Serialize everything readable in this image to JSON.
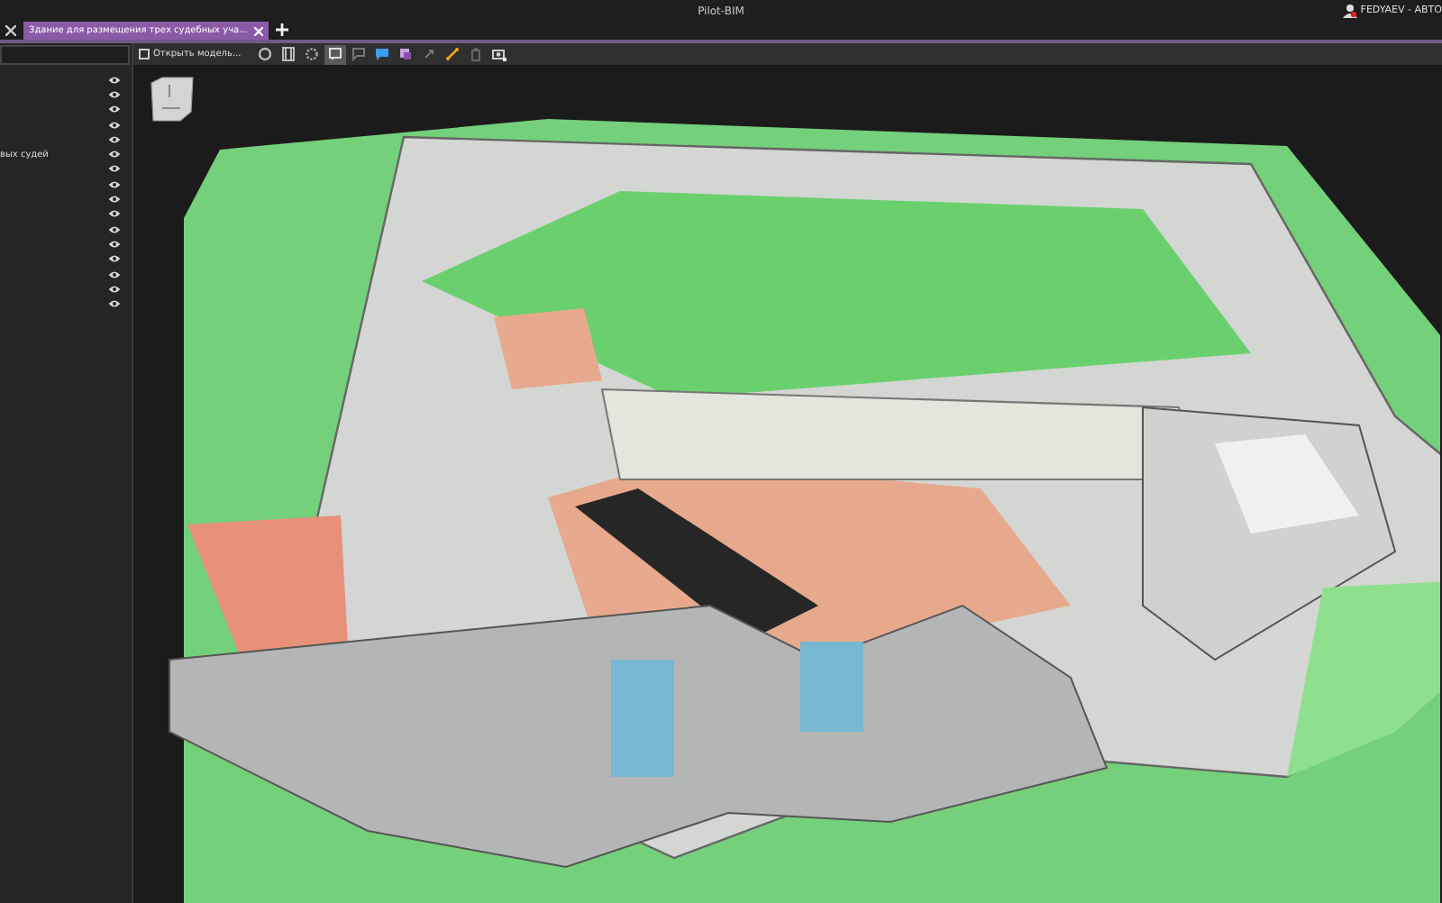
{
  "window": {
    "title": "Pilot-BIM",
    "user": "FEDYAEV - АВТО"
  },
  "tabs": [
    {
      "label": "Здание для размещения трех судебных уча...",
      "selected": true
    }
  ],
  "toolbar": {
    "open_button": "Открыть модель...",
    "tools": [
      {
        "kind": "circle",
        "selected": false
      },
      {
        "kind": "frame",
        "selected": false
      },
      {
        "kind": "gear",
        "selected": false
      },
      {
        "kind": "note",
        "selected": true
      },
      {
        "kind": "flag",
        "selected": false
      },
      {
        "kind": "chat",
        "selected": false
      },
      {
        "kind": "cube",
        "selected": false
      },
      {
        "kind": "arrows",
        "selected": false
      },
      {
        "kind": "measure",
        "selected": false
      },
      {
        "kind": "trash",
        "selected": false
      },
      {
        "kind": "camera",
        "selected": false
      }
    ]
  },
  "layers": [
    {
      "visible": true
    },
    {
      "visible": true
    },
    {
      "visible": true
    },
    {
      "visible": true
    },
    {
      "visible": true
    },
    {
      "label": "вых судей",
      "visible": true
    },
    {
      "visible": true
    },
    {
      "visible": true
    },
    {
      "visible": true
    },
    {
      "visible": true
    },
    {
      "visible": true
    },
    {
      "visible": true
    },
    {
      "visible": true
    },
    {
      "visible": true
    },
    {
      "visible": true
    },
    {
      "visible": true
    }
  ]
}
